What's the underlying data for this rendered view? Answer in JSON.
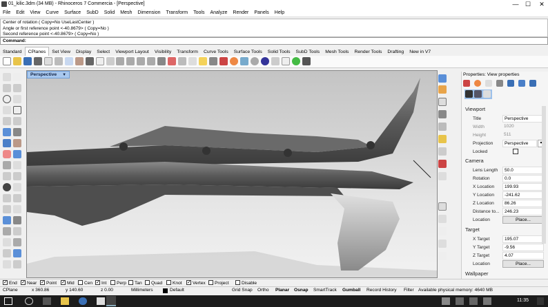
{
  "window": {
    "title": "01_kilic.3dm (34 MB) - Rhinoceros 7 Commercia - [Perspective]",
    "minimize": "—",
    "maximize": "☐",
    "close": "✕"
  },
  "menu": [
    "File",
    "Edit",
    "View",
    "Curve",
    "Surface",
    "SubD",
    "Solid",
    "Mesh",
    "Dimension",
    "Transform",
    "Tools",
    "Analyze",
    "Render",
    "Panels",
    "Help"
  ],
  "command": {
    "history": [
      "Center of rotation ( Copy=No  UseLastCenter )",
      "Angle or first reference point <-40.8679> ( Copy=No )",
      "Second reference point <-40.8679> ( Copy=No )"
    ],
    "prompt": "Command:",
    "value": ""
  },
  "tabs": [
    "Standard",
    "CPlanes",
    "Set View",
    "Display",
    "Select",
    "Viewport Layout",
    "Visibility",
    "Transform",
    "Curve Tools",
    "Surface Tools",
    "Solid Tools",
    "SubD Tools",
    "Mesh Tools",
    "Render Tools",
    "Drafting",
    "New in V7"
  ],
  "active_tab": "Standard",
  "viewport": {
    "name": "Perspective",
    "dropdown_icon": "chevron-down-icon"
  },
  "properties": {
    "title": "Properties: View properties",
    "viewport_section": "Viewport",
    "title_label": "Title",
    "title_value": "Perspective",
    "width_label": "Width",
    "width_value": "1020",
    "height_label": "Height",
    "height_value": "511",
    "projection_label": "Projection",
    "projection_value": "Perspective",
    "locked_label": "Locked",
    "camera_section": "Camera",
    "lens_label": "Lens Length",
    "lens_value": "50.0",
    "rotation_label": "Rotation",
    "rotation_value": "0.0",
    "xloc_label": "X Location",
    "xloc_value": "199.93",
    "yloc_label": "Y Location",
    "yloc_value": "-241.62",
    "zloc_label": "Z Location",
    "zloc_value": "86.26",
    "dist_label": "Distance to...",
    "dist_value": "246.23",
    "location_label": "Location",
    "place_button": "Place...",
    "target_section": "Target",
    "xt_label": "X Target",
    "xt_value": "195.07",
    "yt_label": "Y Target",
    "yt_value": "-9.56",
    "zt_label": "Z Target",
    "zt_value": "4.07",
    "tlocation_label": "Location",
    "tplace_button": "Place...",
    "wallpaper_section": "Wallpaper"
  },
  "osnaps": [
    {
      "label": "End",
      "on": true
    },
    {
      "label": "Near",
      "on": true
    },
    {
      "label": "Point",
      "on": true
    },
    {
      "label": "Mid",
      "on": true
    },
    {
      "label": "Cen",
      "on": false
    },
    {
      "label": "Int",
      "on": true
    },
    {
      "label": "Perp",
      "on": false
    },
    {
      "label": "Tan",
      "on": false
    },
    {
      "label": "Quad",
      "on": false
    },
    {
      "label": "Knot",
      "on": false
    },
    {
      "label": "Vertex",
      "on": true
    },
    {
      "label": "Project",
      "on": false
    },
    {
      "label": "Disable",
      "on": false
    }
  ],
  "status": {
    "cplane": "CPlane",
    "x": "x 360.86",
    "y": "y 140.60",
    "z": "z 0.00",
    "units": "Millimeters",
    "layer": "Default",
    "grid_snap": "Grid Snap",
    "ortho": "Ortho",
    "planar": "Planar",
    "osnap": "Osnap",
    "smarttrack": "SmartTrack",
    "gumball": "Gumball",
    "record_history": "Record History",
    "filter": "Filter",
    "memory": "Available physical memory: 4640 MB"
  },
  "taskbar": {
    "clock": "11:35"
  }
}
